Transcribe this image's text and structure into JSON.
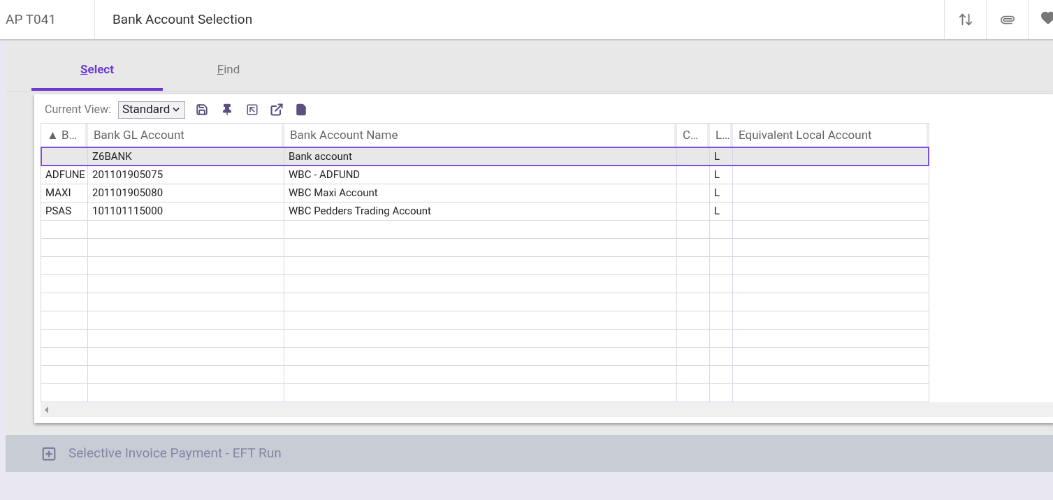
{
  "header": {
    "code": "AP T041",
    "title": "Bank Account Selection"
  },
  "tabs": [
    {
      "label": "Select",
      "selected": true
    },
    {
      "label": "Find",
      "selected": false
    }
  ],
  "view": {
    "label": "Current View:",
    "value": "Standard"
  },
  "table": {
    "columns": [
      "▲ B…",
      "Bank GL Account",
      "Bank Account Name",
      "C…",
      "L…",
      "Equivalent Local Account"
    ],
    "rows": [
      {
        "selected": true,
        "cells": [
          "",
          "Z6BANK",
          "Bank account",
          "",
          "L",
          ""
        ]
      },
      {
        "selected": false,
        "cells": [
          "ADFUNE",
          "201101905075",
          "WBC - ADFUND",
          "",
          "L",
          ""
        ]
      },
      {
        "selected": false,
        "cells": [
          "MAXI",
          "201101905080",
          "WBC Maxi Account",
          "",
          "L",
          ""
        ]
      },
      {
        "selected": false,
        "cells": [
          "PSAS",
          "101101115000",
          "WBC Pedders Trading Account",
          "",
          "L",
          ""
        ]
      }
    ]
  },
  "section": {
    "title": "Selective Invoice Payment - EFT Run",
    "expanded": false
  }
}
